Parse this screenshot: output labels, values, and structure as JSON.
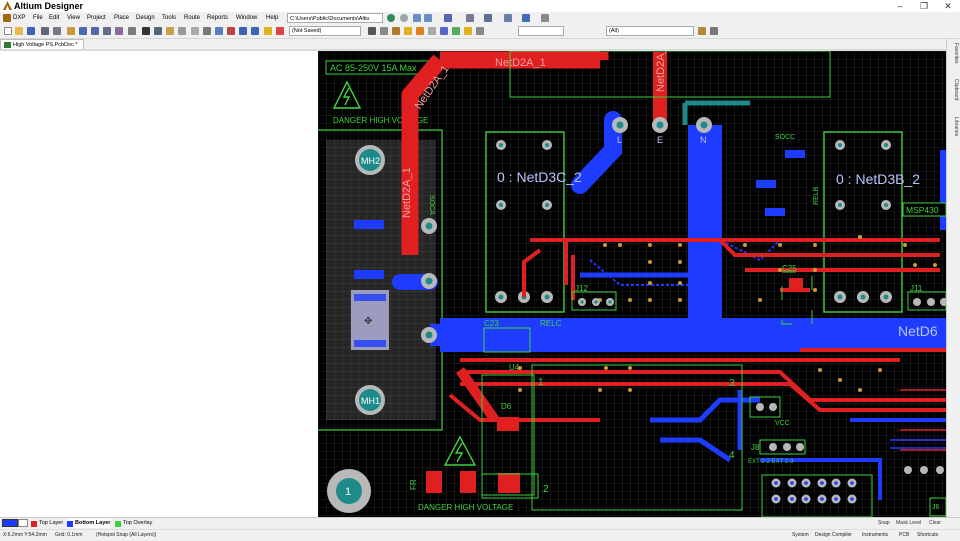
{
  "app": {
    "title": "Altium Designer"
  },
  "window_controls": {
    "minimize": "–",
    "maximize": "❐",
    "close": "✕"
  },
  "menu": {
    "items": [
      "DXP",
      "File",
      "Edit",
      "View",
      "Project",
      "Place",
      "Design",
      "Tools",
      "Route",
      "Reports",
      "Window",
      "Help"
    ],
    "path": "C:\\Users\\Public\\Documents\\Altiu"
  },
  "toolbar": {
    "save_state": "(Not Saved)",
    "filter": "(All)"
  },
  "document_tab": {
    "label": "High Voltage PS.PcbDoc *"
  },
  "right_panels": [
    "Favorites",
    "Clipboard",
    "Libraries"
  ],
  "pcb": {
    "warning_box": "AC 85-250V 15A Max",
    "danger_top": "DANGER HIGH VOLTAGE",
    "danger_bottom": "DANGER HIGH VOLTAGE",
    "nets": {
      "netd2a_top": "NetD2A_1",
      "netd2a_diag": "NetD2A_1",
      "netd2a_vert": "NetD2A_1",
      "netd2a_left": "NetD2A_1",
      "netd6": "NetD6"
    },
    "relay_labels": {
      "left": "0 : NetD3C_2",
      "right": "0 : NetD3B_2"
    },
    "labels": {
      "mh2": "MH2",
      "mh1": "MH1",
      "l": "L",
      "e": "E",
      "n": "N",
      "socc": "SOCC",
      "relb": "RELB",
      "relc": "RELC",
      "soca": "SOCA",
      "c23": "C23",
      "c25": "C25",
      "j12": "J12",
      "j11": "J11",
      "d6": "D6",
      "u4": "U4",
      "msp430": "MSP430",
      "vcc": "VCC",
      "j8": "J8",
      "j6": "J6",
      "mark1": "1",
      "fuse": "FR",
      "pin1": "1",
      "pin2": "2",
      "pin3": "3",
      "pin4": "4",
      "ext": "EXT 2-2  EXT 2-3",
      "ac_l": "L",
      "ac_e": "E",
      "ac_n": "N"
    }
  },
  "layer_tabs": [
    {
      "label": "Top Layer",
      "color": "#e02020"
    },
    {
      "label": "Bottom Layer",
      "color": "#1e3cff"
    },
    {
      "label": "Top Overlay",
      "color": "#3fd13f"
    }
  ],
  "layer_bar_right": {
    "snap": "Snap",
    "mask": "Mask Level",
    "clear": "Clear"
  },
  "status": {
    "coords": "X:6.2mm Y:54.2mm",
    "grid": "Grid: 0.1mm",
    "snap": "(Hotspot Snap (All Layers))",
    "panels": [
      "System",
      "Design Compiler",
      "Instruments",
      "PCB",
      "Shortcuts"
    ]
  },
  "colors": {
    "top_layer": "#e02020",
    "bottom_layer": "#1e3cff",
    "overlay": "#3fd13f",
    "pad": "#b8b8b8",
    "via_hole": "#1e8a8a",
    "canvas": "#000000",
    "grid": "#3a3a3a"
  }
}
